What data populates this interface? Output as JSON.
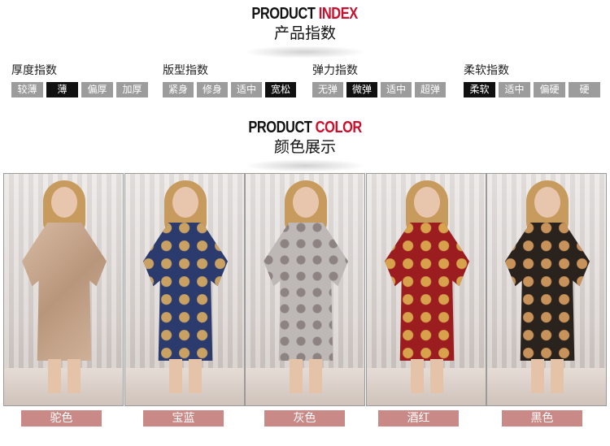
{
  "index_heading": {
    "en_prefix": "PRODUCT ",
    "en_highlight": "INDEX",
    "cn": "产品指数"
  },
  "indices": [
    {
      "title": "厚度指数",
      "options": [
        "较薄",
        "薄",
        "偏厚",
        "加厚"
      ],
      "selected": 1
    },
    {
      "title": "版型指数",
      "options": [
        "紧身",
        "修身",
        "适中",
        "宽松"
      ],
      "selected": 3
    },
    {
      "title": "弹力指数",
      "options": [
        "无弹",
        "微弹",
        "适中",
        "超弹"
      ],
      "selected": 1
    },
    {
      "title": "柔软指数",
      "options": [
        "柔软",
        "适中",
        "偏硬",
        "硬"
      ],
      "selected": 0
    }
  ],
  "color_heading": {
    "en_prefix": "PRODUCT ",
    "en_highlight": "COLOR",
    "cn": "颜色展示"
  },
  "colors": [
    {
      "name": "驼色",
      "swatch": "#c9a98f"
    },
    {
      "name": "宝蓝",
      "swatch": "#2b3b6e"
    },
    {
      "name": "灰色",
      "swatch": "#b9b3b2"
    },
    {
      "name": "酒红",
      "swatch": "#9b1d1f"
    },
    {
      "name": "黑色",
      "swatch": "#2a221c"
    }
  ],
  "theme": {
    "highlight": "#c8102e",
    "chip_on": "#111111",
    "chip_off": "#9c9c9c",
    "label_bg": "#c98a87"
  }
}
